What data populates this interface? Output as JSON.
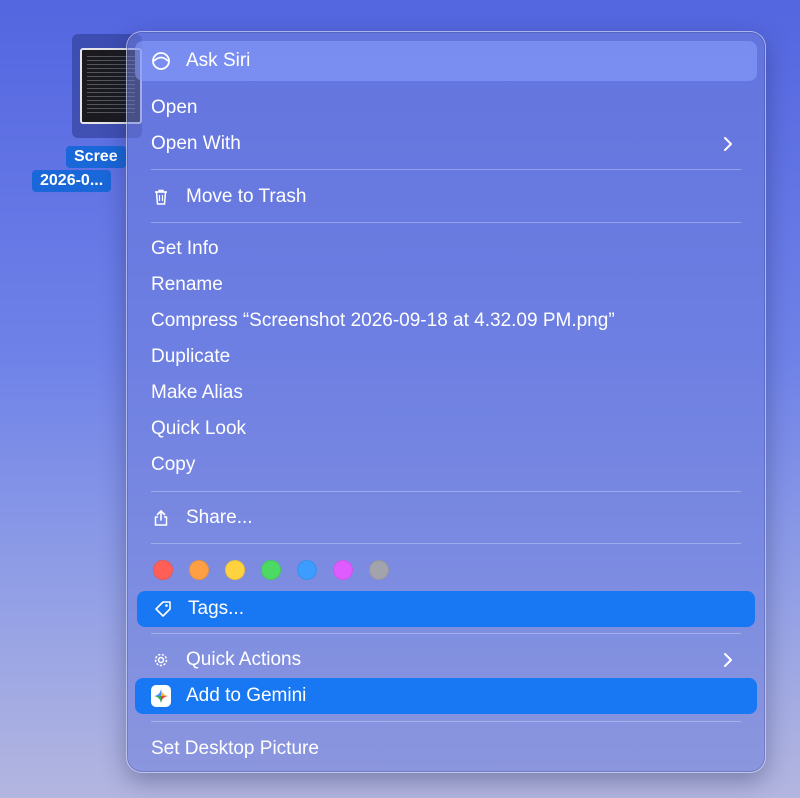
{
  "desktop_file": {
    "name_line_1": "Scree",
    "name_line_2": "2026-0..."
  },
  "context_menu": {
    "ask_siri": "Ask Siri",
    "open": "Open",
    "open_with": "Open With",
    "move_to_trash": "Move to Trash",
    "get_info": "Get Info",
    "rename": "Rename",
    "compress": "Compress “Screenshot 2026-09-18 at 4.32.09 PM.png”",
    "duplicate": "Duplicate",
    "make_alias": "Make Alias",
    "quick_look": "Quick Look",
    "copy": "Copy",
    "share": "Share...",
    "tag_colors": [
      {
        "name": "red",
        "color": "#ff5f57"
      },
      {
        "name": "orange",
        "color": "#ff9f43"
      },
      {
        "name": "yellow",
        "color": "#ffd23f"
      },
      {
        "name": "green",
        "color": "#4cd964"
      },
      {
        "name": "blue",
        "color": "#3d9cff"
      },
      {
        "name": "purple",
        "color": "#df5bff"
      },
      {
        "name": "gray",
        "color": "#a3a3ad"
      }
    ],
    "tags": "Tags...",
    "quick_actions": "Quick Actions",
    "add_to_gemini": "Add to Gemini",
    "set_desktop_picture": "Set Desktop Picture"
  },
  "colors": {
    "highlight": "#1877f2",
    "siri_highlight": "#8ca0ff"
  },
  "icons": {
    "ask_siri": "siri-icon",
    "move_to_trash": "trash-icon",
    "share": "share-icon",
    "tags": "tag-icon",
    "quick_actions": "gear-icon",
    "add_to_gemini": "gemini-icon",
    "submenu": "chevron-right-icon"
  }
}
